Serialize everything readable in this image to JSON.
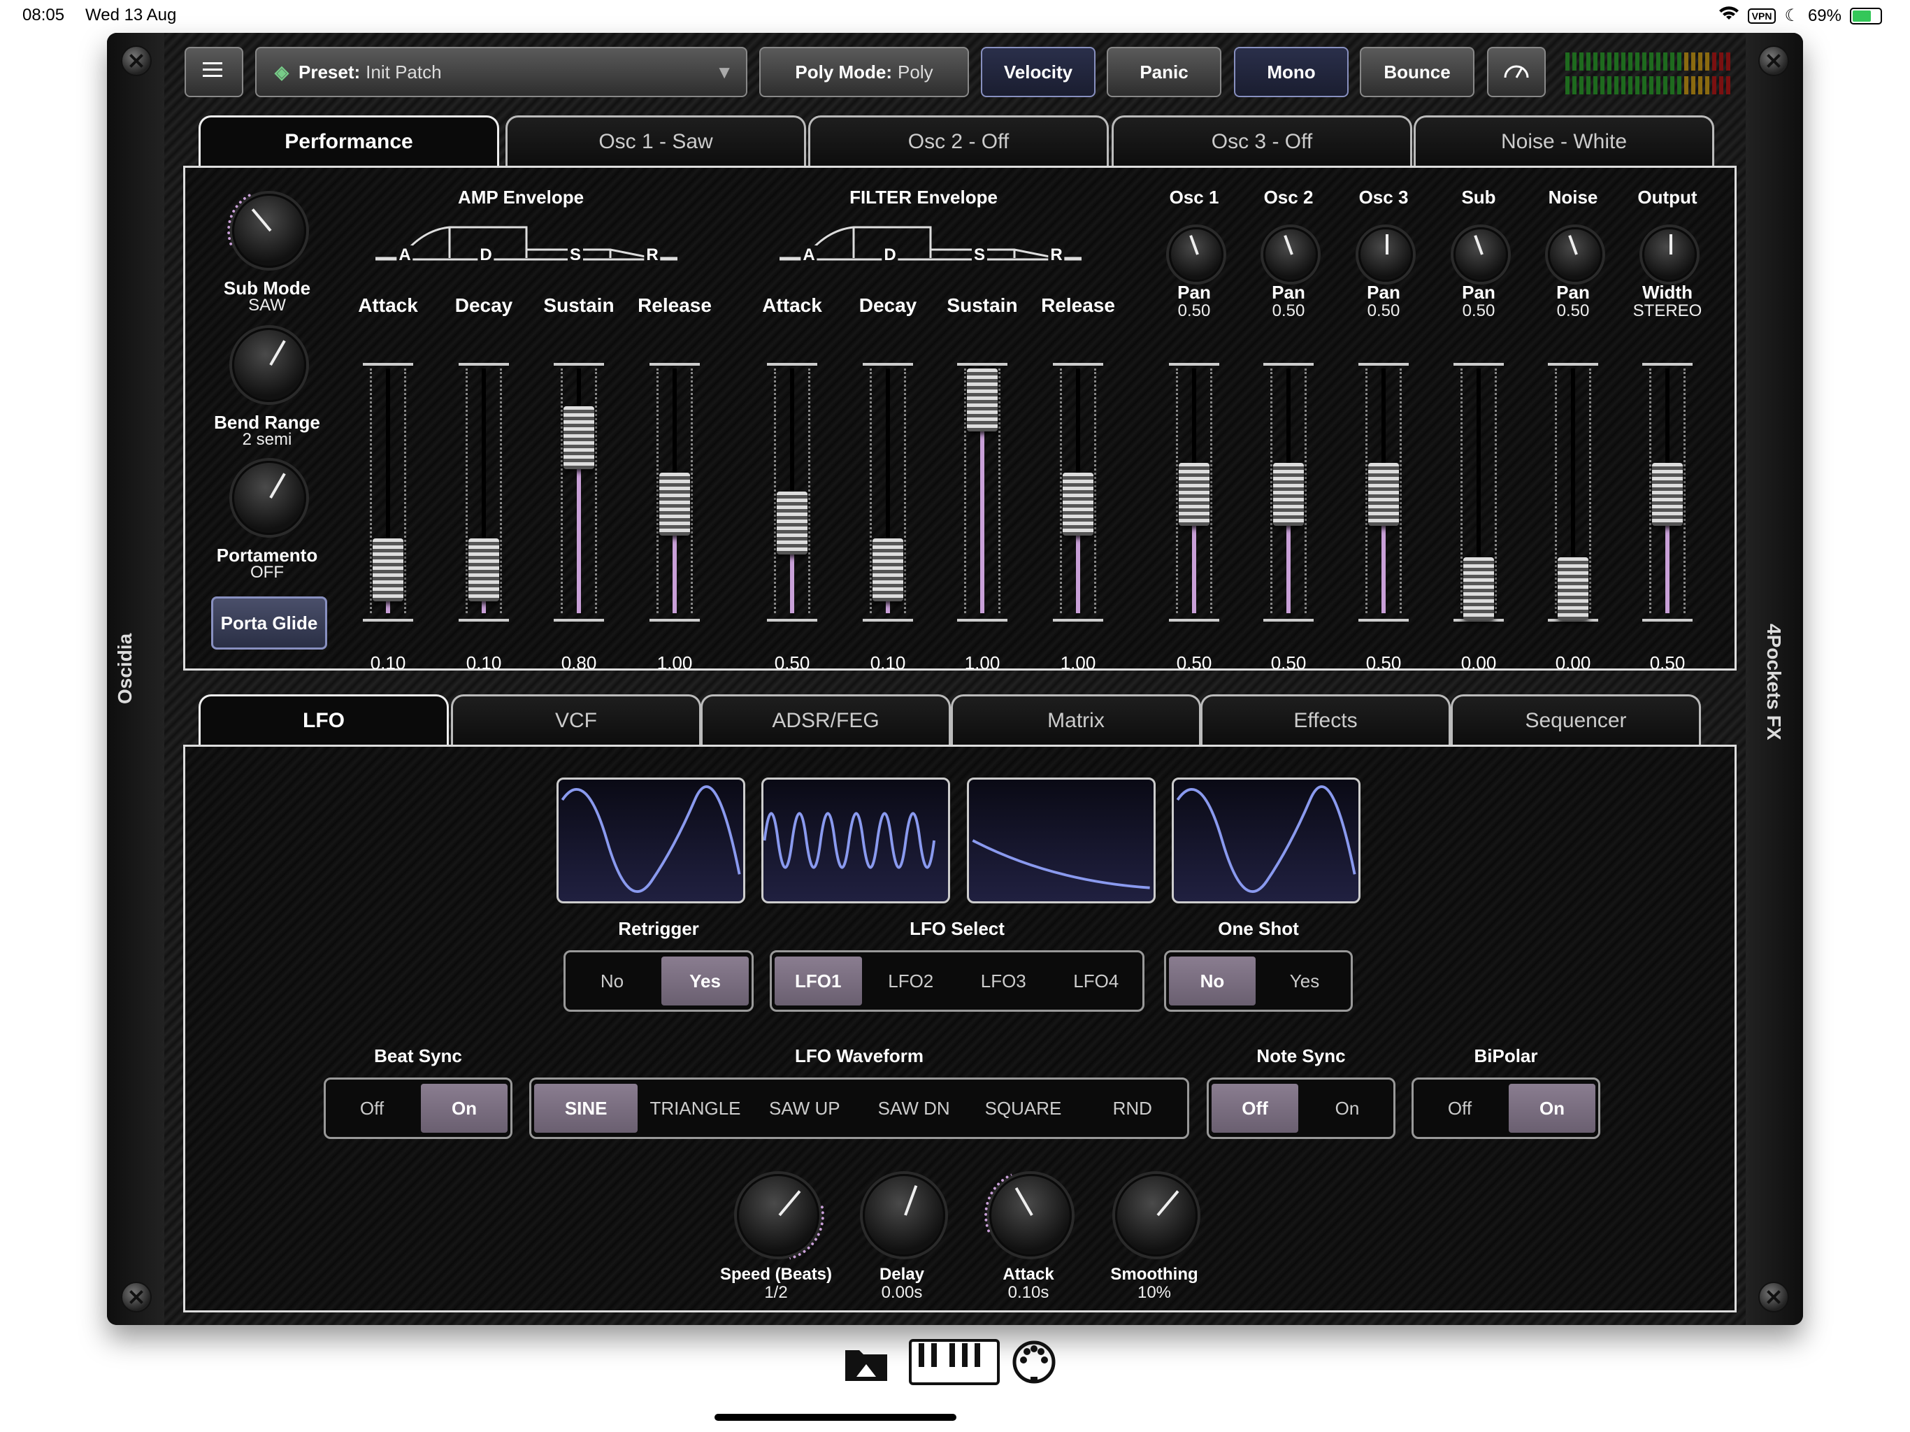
{
  "status": {
    "time": "08:05",
    "date": "Wed 13 Aug",
    "vpn": "VPN",
    "battery": "69%"
  },
  "toolbar": {
    "preset_label": "Preset:",
    "preset_value": "Init Patch",
    "poly_label": "Poly Mode:",
    "poly_value": "Poly",
    "velocity": "Velocity",
    "panic": "Panic",
    "mono": "Mono",
    "bounce": "Bounce"
  },
  "side": {
    "left": "Oscidia",
    "right": "4Pockets FX"
  },
  "top_tabs": [
    {
      "label": "Performance"
    },
    {
      "label": "Osc 1 - Saw"
    },
    {
      "label": "Osc 2 - Off"
    },
    {
      "label": "Osc 3 - Off"
    },
    {
      "label": "Noise - White"
    }
  ],
  "perf": {
    "knobs": [
      {
        "label": "Sub Mode",
        "value": "SAW"
      },
      {
        "label": "Bend Range",
        "value": "2 semi"
      },
      {
        "label": "Portamento",
        "value": "OFF"
      }
    ],
    "porta_glide": "Porta Glide",
    "amp_env_title": "AMP Envelope",
    "filter_env_title": "FILTER Envelope",
    "env_letters": [
      "A",
      "D",
      "S",
      "R"
    ],
    "faders": [
      {
        "label": "Attack",
        "value": "0.10",
        "level": 0.1
      },
      {
        "label": "Decay",
        "value": "0.10",
        "level": 0.1
      },
      {
        "label": "Sustain",
        "value": "0.80",
        "level": 0.8
      },
      {
        "label": "Release",
        "value": "1.00",
        "level": 0.45
      },
      {
        "label": "Attack",
        "value": "0.50",
        "level": 0.35
      },
      {
        "label": "Decay",
        "value": "0.10",
        "level": 0.1
      },
      {
        "label": "Sustain",
        "value": "1.00",
        "level": 1.0
      },
      {
        "label": "Release",
        "value": "1.00",
        "level": 0.45
      },
      {
        "label": "Pan",
        "value": "0.50",
        "level": 0.5
      },
      {
        "label": "Pan",
        "value": "0.50",
        "level": 0.5
      },
      {
        "label": "Pan",
        "value": "0.50",
        "level": 0.5
      },
      {
        "label": "Pan",
        "value": "0.00",
        "level": 0.0
      },
      {
        "label": "Pan",
        "value": "0.00",
        "level": 0.0
      },
      {
        "label": "Width",
        "value": "0.50",
        "level": 0.5
      }
    ],
    "mix_cols": [
      {
        "title": "Osc 1",
        "sub": "Pan",
        "subval": "0.50"
      },
      {
        "title": "Osc 2",
        "sub": "Pan",
        "subval": "0.50"
      },
      {
        "title": "Osc 3",
        "sub": "Pan",
        "subval": "0.50"
      },
      {
        "title": "Sub",
        "sub": "Pan",
        "subval": "0.50"
      },
      {
        "title": "Noise",
        "sub": "Pan",
        "subval": "0.50"
      },
      {
        "title": "Output",
        "sub": "Width",
        "subval": "STEREO"
      }
    ]
  },
  "bottom_tabs": [
    {
      "label": "LFO"
    },
    {
      "label": "VCF"
    },
    {
      "label": "ADSR/FEG"
    },
    {
      "label": "Matrix"
    },
    {
      "label": "Effects"
    },
    {
      "label": "Sequencer"
    }
  ],
  "lfo": {
    "retrigger": {
      "title": "Retrigger",
      "options": [
        "No",
        "Yes"
      ],
      "selected": 1
    },
    "lfo_select": {
      "title": "LFO Select",
      "options": [
        "LFO1",
        "LFO2",
        "LFO3",
        "LFO4"
      ],
      "selected": 0
    },
    "one_shot": {
      "title": "One Shot",
      "options": [
        "No",
        "Yes"
      ],
      "selected": 0
    },
    "beat_sync": {
      "title": "Beat Sync",
      "options": [
        "Off",
        "On"
      ],
      "selected": 1
    },
    "waveform": {
      "title": "LFO Waveform",
      "options": [
        "SINE",
        "TRIANGLE",
        "SAW UP",
        "SAW DN",
        "SQUARE",
        "RND"
      ],
      "selected": 0
    },
    "note_sync": {
      "title": "Note Sync",
      "options": [
        "Off",
        "On"
      ],
      "selected": 0
    },
    "bipolar": {
      "title": "BiPolar",
      "options": [
        "Off",
        "On"
      ],
      "selected": 1
    },
    "knobs": [
      {
        "label": "Speed (Beats)",
        "value": "1/2"
      },
      {
        "label": "Delay",
        "value": "0.00s"
      },
      {
        "label": "Attack",
        "value": "0.10s"
      },
      {
        "label": "Smoothing",
        "value": "10%"
      }
    ]
  },
  "colors": {
    "accent": "#c9a0d8",
    "selected": "#7a6d80",
    "active_border": "#8890c0"
  },
  "icons": [
    "menu-icon",
    "preset-icon",
    "gauge-icon",
    "folder-icon",
    "keyboard-icon",
    "midi-icon",
    "wifi-icon",
    "moon-icon",
    "battery-icon"
  ]
}
